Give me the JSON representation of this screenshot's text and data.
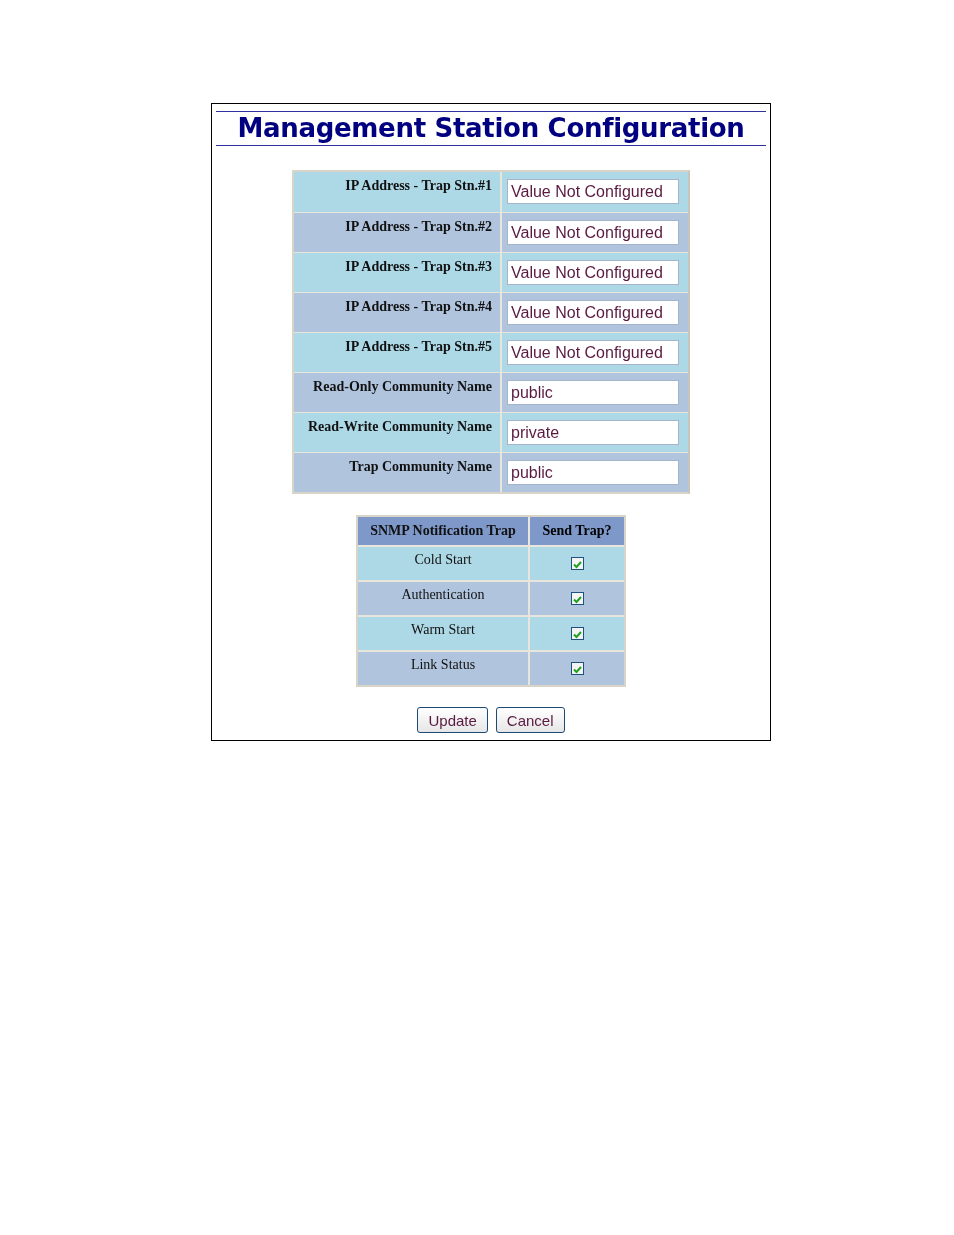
{
  "title": "Management Station Configuration",
  "settings": [
    {
      "label": "IP Address - Trap Stn.#1",
      "value": "Value Not Configured"
    },
    {
      "label": "IP Address - Trap Stn.#2",
      "value": "Value Not Configured"
    },
    {
      "label": "IP Address - Trap Stn.#3",
      "value": "Value Not Configured"
    },
    {
      "label": "IP Address - Trap Stn.#4",
      "value": "Value Not Configured"
    },
    {
      "label": "IP Address - Trap Stn.#5",
      "value": "Value Not Configured"
    },
    {
      "label": "Read-Only Community Name",
      "value": "public"
    },
    {
      "label": "Read-Write Community Name",
      "value": "private"
    },
    {
      "label": "Trap Community Name",
      "value": "public"
    }
  ],
  "traps": {
    "columns": [
      "SNMP Notification Trap",
      "Send Trap?"
    ],
    "rows": [
      {
        "name": "Cold Start",
        "checked": true
      },
      {
        "name": "Authentication",
        "checked": true
      },
      {
        "name": "Warm Start",
        "checked": true
      },
      {
        "name": "Link Status",
        "checked": true
      }
    ]
  },
  "buttons": [
    "Update",
    "Cancel"
  ]
}
